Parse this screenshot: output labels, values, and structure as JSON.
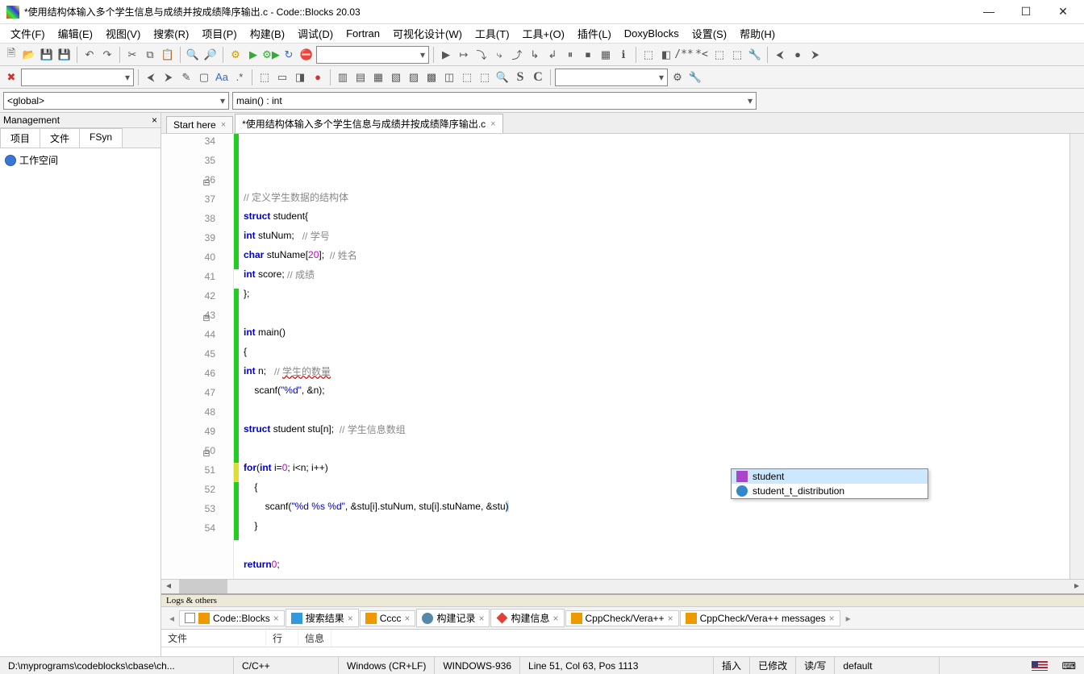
{
  "window": {
    "title": "*使用结构体输入多个学生信息与成绩并按成绩降序输出.c - Code::Blocks 20.03"
  },
  "menu": [
    "文件(F)",
    "编辑(E)",
    "视图(V)",
    "搜索(R)",
    "项目(P)",
    "构建(B)",
    "调试(D)",
    "Fortran",
    "可视化设计(W)",
    "工具(T)",
    "工具+(O)",
    "插件(L)",
    "DoxyBlocks",
    "设置(S)",
    "帮助(H)"
  ],
  "scope_combo": "<global>",
  "func_combo": "main() : int",
  "sidebar": {
    "title": "Management",
    "tabs": [
      "项目",
      "文件",
      "FSyn"
    ],
    "workspace": "工作空间"
  },
  "editor_tabs": [
    {
      "label": "Start here",
      "active": false
    },
    {
      "label": "*使用结构体输入多个学生信息与成绩并按成绩降序输出.c",
      "active": true
    }
  ],
  "line_start": 34,
  "code_lines": [
    {
      "n": 34,
      "fold": "",
      "ch": "green",
      "html": ""
    },
    {
      "n": 35,
      "fold": "",
      "ch": "green",
      "html": "    <span class='cm'>// 定义学生数据的结构体</span>"
    },
    {
      "n": 36,
      "fold": "⊟",
      "ch": "green",
      "html": "<span class='kw'>struct</span> student{"
    },
    {
      "n": 37,
      "fold": "",
      "ch": "green",
      "html": "    <span class='kw'>int</span> stuNum;   <span class='cm'>// 学号</span>"
    },
    {
      "n": 38,
      "fold": "",
      "ch": "green",
      "html": "    <span class='kw'>char</span> stuName[<span class='num'>20</span>];  <span class='cm'>// 姓名</span>"
    },
    {
      "n": 39,
      "fold": "",
      "ch": "green",
      "html": "    <span class='kw'>int</span> score; <span class='cm'>// 成绩</span>"
    },
    {
      "n": 40,
      "fold": "",
      "ch": "green",
      "html": "};"
    },
    {
      "n": 41,
      "fold": "",
      "ch": "",
      "html": ""
    },
    {
      "n": 42,
      "fold": "",
      "ch": "green",
      "html": "<span class='kw'>int</span> main()"
    },
    {
      "n": 43,
      "fold": "⊟",
      "ch": "green",
      "html": "{"
    },
    {
      "n": 44,
      "fold": "",
      "ch": "green",
      "html": "    <span class='kw'>int</span> n;   <span class='cm'>// <span class='wavy'>学生的数量</span></span>"
    },
    {
      "n": 45,
      "fold": "",
      "ch": "green",
      "html": "    scanf(<span class='str'>\"%d\"</span>, &amp;n);"
    },
    {
      "n": 46,
      "fold": "",
      "ch": "green",
      "html": ""
    },
    {
      "n": 47,
      "fold": "",
      "ch": "green",
      "html": "    <span class='kw'>struct</span> student stu[n];  <span class='cm'>// 学生信息数组</span>"
    },
    {
      "n": 48,
      "fold": "",
      "ch": "green",
      "html": ""
    },
    {
      "n": 49,
      "fold": "",
      "ch": "green",
      "html": "    <span class='kw'>for</span>(<span class='kw'>int</span> i=<span class='num'>0</span>; i&lt;n; i++)"
    },
    {
      "n": 50,
      "fold": "⊟",
      "ch": "green",
      "html": "    {"
    },
    {
      "n": 51,
      "fold": "",
      "ch": "yellow",
      "html": "        scanf(<span class='str'>\"%d %s %d\"</span>, &amp;stu[i].stuNum, stu[i].stuName, &amp;stu<span style='background:#cde7ff;'>)</span>"
    },
    {
      "n": 52,
      "fold": "",
      "ch": "green",
      "html": "    }"
    },
    {
      "n": 53,
      "fold": "",
      "ch": "green",
      "html": ""
    },
    {
      "n": 54,
      "fold": "",
      "ch": "green",
      "html": "    <span class='kw'>return</span> <span class='num'>0</span>;"
    }
  ],
  "autocomplete": [
    {
      "icon": "st",
      "label": "student",
      "sel": true
    },
    {
      "icon": "cp",
      "label": "student_t_distribution",
      "sel": false
    }
  ],
  "logs": {
    "title": "Logs & others",
    "tabs": [
      "Code::Blocks",
      "搜索结果",
      "Cccc",
      "构建记录",
      "构建信息",
      "CppCheck/Vera++",
      "CppCheck/Vera++ messages"
    ],
    "cols": [
      "文件",
      "行",
      "信息"
    ]
  },
  "status": {
    "path": "D:\\myprograms\\codeblocks\\cbase\\ch...",
    "lang": "C/C++",
    "eol": "Windows (CR+LF)",
    "enc": "WINDOWS-936",
    "pos": "Line 51, Col 63, Pos 1113",
    "ins": "插入",
    "mod": "已修改",
    "rw": "读/写",
    "prof": "default"
  }
}
